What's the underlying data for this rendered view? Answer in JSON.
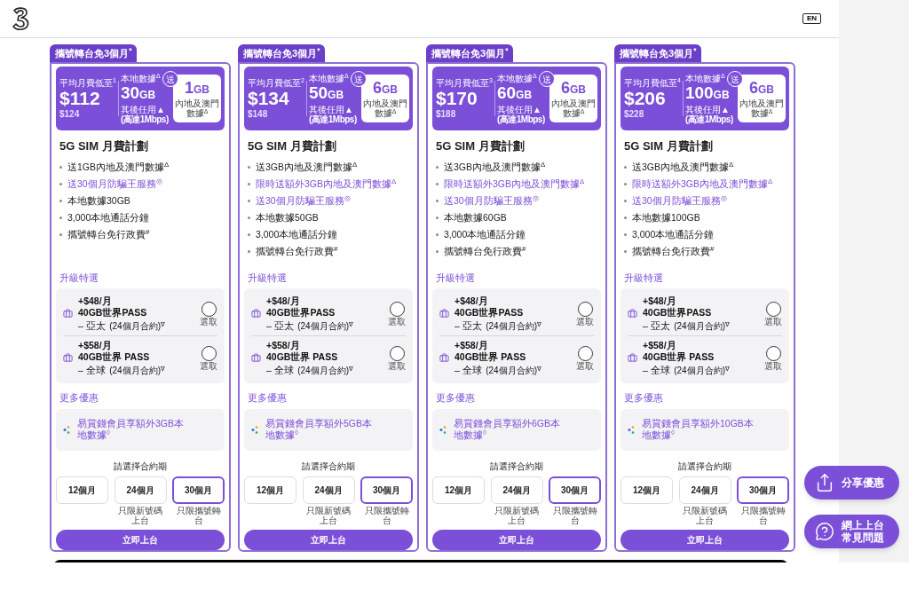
{
  "header": {
    "language_button": "EN"
  },
  "plans": [
    {
      "tab": "攜號轉台免3個月$^{*}$",
      "price_label": "平均月費低至$^{1}$",
      "price": "$112",
      "original_price": "$124",
      "data_label": "本地數據$^{Δ}$",
      "data_amount": "30",
      "data_unit": "GB",
      "data_note": "其後任用▲",
      "data_speed": "(高達1Mbps)",
      "bonus_badge": "送",
      "bonus_amount": "1",
      "bonus_unit": "GB",
      "bonus_caption": "內地及澳門數據$^{Δ}$",
      "title": "5G SIM 月費計劃",
      "features": [
        {
          "text": "送1GB內地及澳門數據$^{Δ}$",
          "highlight": false
        },
        {
          "text": "送30個月防騙王服務$^{◎}$",
          "highlight": true
        },
        {
          "text": "本地數據30GB",
          "highlight": false
        },
        {
          "text": "3,000本地通話分鐘",
          "highlight": false
        },
        {
          "text": "攜號轉台免行政費$^{#}$",
          "highlight": false
        }
      ],
      "upgrade_title": "升級特選",
      "upgrades": [
        {
          "price": "+$48/月",
          "name": "40GB世界PASS",
          "region": "– 亞太",
          "term": "(24個月合約)$^{∇}$",
          "select_label": "選取",
          "checked": false
        },
        {
          "price": "+$58/月",
          "name": "40GB世界 PASS",
          "region": "– 全球",
          "term": "(24個月合約)$^{∇}$",
          "select_label": "選取",
          "checked": false
        }
      ],
      "more_title": "更多優惠",
      "more_offer": "易賞錢會員享額外3GB本地數據$^{◊}$",
      "contract_prompt": "請選擇合約期",
      "contracts": [
        {
          "label": "12個月",
          "selected": false
        },
        {
          "label": "24個月",
          "note": "只限新號碼上台",
          "selected": false
        },
        {
          "label": "30個月",
          "note": "只限攜號轉台",
          "selected": true
        }
      ],
      "cta": "立即上台"
    },
    {
      "tab": "攜號轉台免3個月$^{*}$",
      "price_label": "平均月費低至$^{2}$",
      "price": "$134",
      "original_price": "$148",
      "data_label": "本地數據$^{Δ}$",
      "data_amount": "50",
      "data_unit": "GB",
      "data_note": "其後任用▲",
      "data_speed": "(高達1Mbps)",
      "bonus_badge": "送",
      "bonus_amount": "6",
      "bonus_unit": "GB",
      "bonus_caption": "內地及澳門數據$^{Δ}$",
      "title": "5G SIM 月費計劃",
      "features": [
        {
          "text": "送3GB內地及澳門數據$^{Δ}$",
          "highlight": false
        },
        {
          "text": "限時送額外3GB內地及澳門數據$^{Δ}$",
          "highlight": true
        },
        {
          "text": "送30個月防騙王服務$^{◎}$",
          "highlight": true
        },
        {
          "text": "本地數據50GB",
          "highlight": false
        },
        {
          "text": "3,000本地通話分鐘",
          "highlight": false
        },
        {
          "text": "攜號轉台免行政費$^{#}$",
          "highlight": false
        }
      ],
      "upgrade_title": "升級特選",
      "upgrades": [
        {
          "price": "+$48/月",
          "name": "40GB世界PASS",
          "region": "– 亞太",
          "term": "(24個月合約)$^{∇}$",
          "select_label": "選取",
          "checked": false
        },
        {
          "price": "+$58/月",
          "name": "40GB世界 PASS",
          "region": "– 全球",
          "term": "(24個月合約)$^{∇}$",
          "select_label": "選取",
          "checked": false
        }
      ],
      "more_title": "更多優惠",
      "more_offer": "易賞錢會員享額外5GB本地數據$^{◊}$",
      "contract_prompt": "請選擇合約期",
      "contracts": [
        {
          "label": "12個月",
          "selected": false
        },
        {
          "label": "24個月",
          "note": "只限新號碼上台",
          "selected": false
        },
        {
          "label": "30個月",
          "note": "只限攜號轉台",
          "selected": true
        }
      ],
      "cta": "立即上台"
    },
    {
      "tab": "攜號轉台免3個月$^{*}$",
      "price_label": "平均月費低至$^{3}$",
      "price": "$170",
      "original_price": "$188",
      "data_label": "本地數據$^{Δ}$",
      "data_amount": "60",
      "data_unit": "GB",
      "data_note": "其後任用▲",
      "data_speed": "(高達1Mbps)",
      "bonus_badge": "送",
      "bonus_amount": "6",
      "bonus_unit": "GB",
      "bonus_caption": "內地及澳門數據$^{Δ}$",
      "title": "5G SIM 月費計劃",
      "features": [
        {
          "text": "送3GB內地及澳門數據$^{Δ}$",
          "highlight": false
        },
        {
          "text": "限時送額外3GB內地及澳門數據$^{Δ}$",
          "highlight": true
        },
        {
          "text": "送30個月防騙王服務$^{◎}$",
          "highlight": true
        },
        {
          "text": "本地數據60GB",
          "highlight": false
        },
        {
          "text": "3,000本地通話分鐘",
          "highlight": false
        },
        {
          "text": "攜號轉台免行政費$^{#}$",
          "highlight": false
        }
      ],
      "upgrade_title": "升級特選",
      "upgrades": [
        {
          "price": "+$48/月",
          "name": "40GB世界PASS",
          "region": "– 亞太",
          "term": "(24個月合約)$^{∇}$",
          "select_label": "選取",
          "checked": false
        },
        {
          "price": "+$58/月",
          "name": "40GB世界 PASS",
          "region": "– 全球",
          "term": "(24個月合約)$^{∇}$",
          "select_label": "選取",
          "checked": false
        }
      ],
      "more_title": "更多優惠",
      "more_offer": "易賞錢會員享額外6GB本地數據$^{◊}$",
      "contract_prompt": "請選擇合約期",
      "contracts": [
        {
          "label": "12個月",
          "selected": false
        },
        {
          "label": "24個月",
          "note": "只限新號碼上台",
          "selected": false
        },
        {
          "label": "30個月",
          "note": "只限攜號轉台",
          "selected": true
        }
      ],
      "cta": "立即上台"
    },
    {
      "tab": "攜號轉台免3個月$^{*}$",
      "price_label": "平均月費低至$^{4}$",
      "price": "$206",
      "original_price": "$228",
      "data_label": "本地數據$^{Δ}$",
      "data_amount": "100",
      "data_unit": "GB",
      "data_note": "其後任用▲",
      "data_speed": "(高達1Mbps)",
      "bonus_badge": "送",
      "bonus_amount": "6",
      "bonus_unit": "GB",
      "bonus_caption": "內地及澳門數據$^{Δ}$",
      "title": "5G SIM 月費計劃",
      "features": [
        {
          "text": "送3GB內地及澳門數據$^{Δ}$",
          "highlight": false
        },
        {
          "text": "限時送額外3GB內地及澳門數據$^{Δ}$",
          "highlight": true
        },
        {
          "text": "送30個月防騙王服務$^{◎}$",
          "highlight": true
        },
        {
          "text": "本地數據100GB",
          "highlight": false
        },
        {
          "text": "3,000本地通話分鐘",
          "highlight": false
        },
        {
          "text": "攜號轉台免行政費$^{#}$",
          "highlight": false
        }
      ],
      "upgrade_title": "升級特選",
      "upgrades": [
        {
          "price": "+$48/月",
          "name": "40GB世界PASS",
          "region": "– 亞太",
          "term": "(24個月合約)$^{∇}$",
          "select_label": "選取",
          "checked": false
        },
        {
          "price": "+$58/月",
          "name": "40GB世界 PASS",
          "region": "– 全球",
          "term": "(24個月合約)$^{∇}$",
          "select_label": "選取",
          "checked": false
        }
      ],
      "more_title": "更多優惠",
      "more_offer": "易賞錢會員享額外10GB本地數據$^{◊}$",
      "contract_prompt": "請選擇合約期",
      "contracts": [
        {
          "label": "12個月",
          "selected": false
        },
        {
          "label": "24個月",
          "note": "只限新號碼上台",
          "selected": false
        },
        {
          "label": "30個月",
          "note": "只限攜號轉台",
          "selected": true
        }
      ],
      "cta": "立即上台"
    }
  ],
  "floating_buttons": [
    {
      "kind": "share",
      "label": "分享優惠"
    },
    {
      "kind": "help",
      "label": "網上上台常見問題"
    }
  ]
}
